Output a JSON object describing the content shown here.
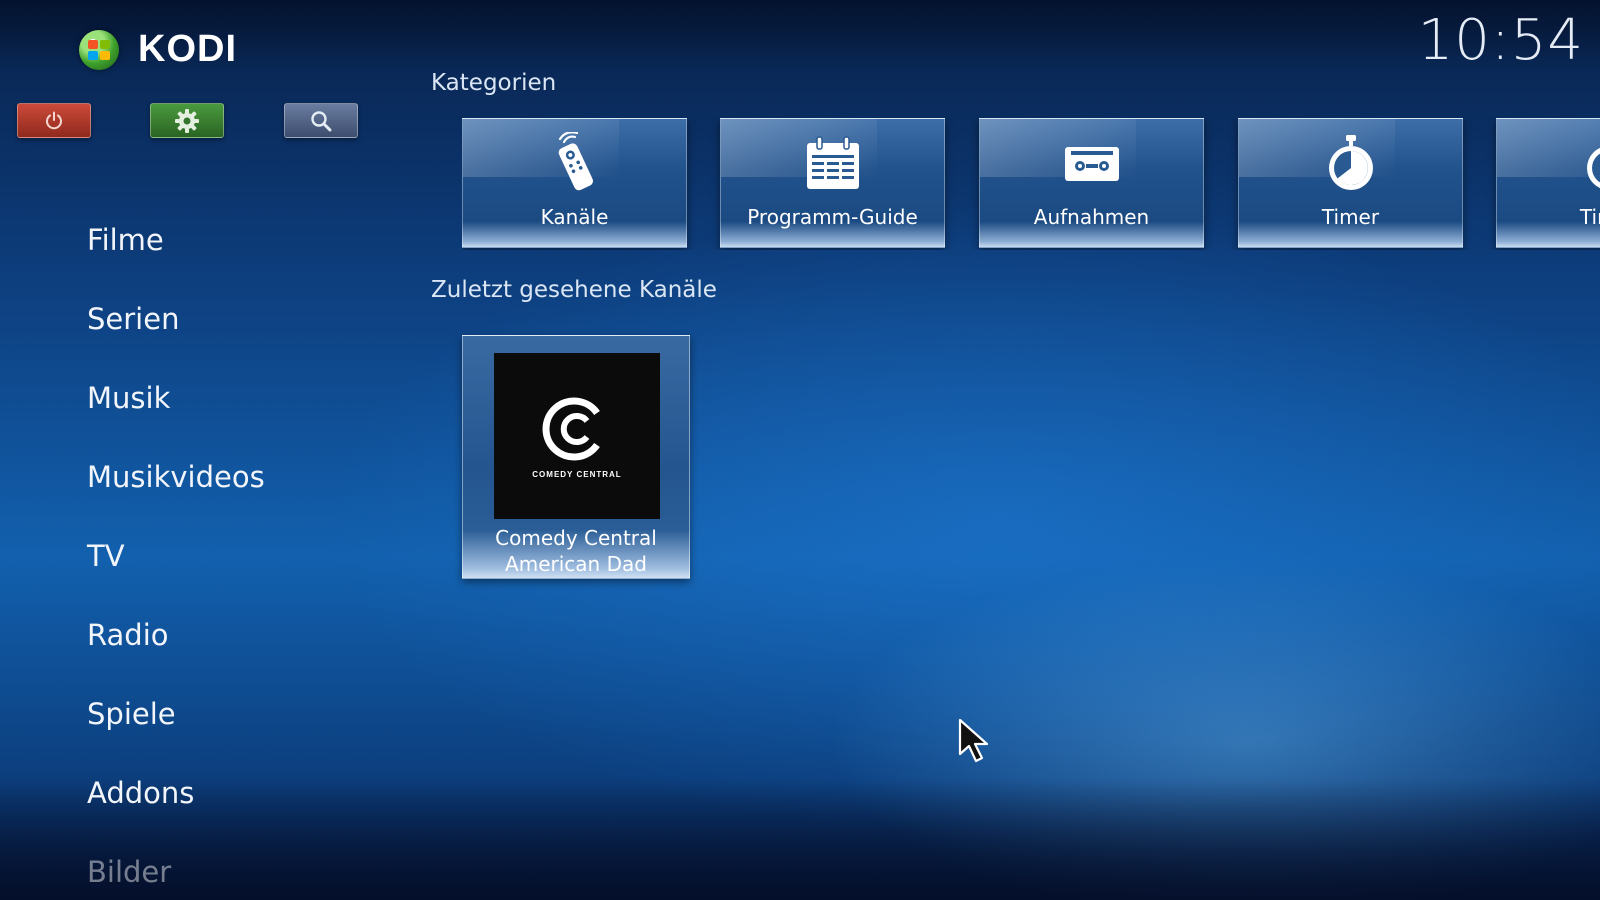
{
  "app": {
    "logo_text": "KODI",
    "clock": "10:54"
  },
  "top_buttons": [
    {
      "name": "power",
      "icon": "power-icon",
      "color": "#b23a2c"
    },
    {
      "name": "settings",
      "icon": "gear-icon",
      "color": "#3d8433"
    },
    {
      "name": "search",
      "icon": "search-icon",
      "color": "#55678a"
    }
  ],
  "sidebar": {
    "items": [
      {
        "label": "Filme"
      },
      {
        "label": "Serien"
      },
      {
        "label": "Musik"
      },
      {
        "label": "Musikvideos"
      },
      {
        "label": "TV"
      },
      {
        "label": "Radio"
      },
      {
        "label": "Spiele"
      },
      {
        "label": "Addons"
      },
      {
        "label": "Bilder"
      }
    ]
  },
  "categories": {
    "title": "Kategorien",
    "items": [
      {
        "label": "Kanäle",
        "icon": "remote-icon"
      },
      {
        "label": "Programm-Guide",
        "icon": "calendar-icon"
      },
      {
        "label": "Aufnahmen",
        "icon": "cassette-icon"
      },
      {
        "label": "Timer",
        "icon": "stopwatch-icon"
      },
      {
        "label": "Timer",
        "icon": "timer-rule-icon"
      }
    ]
  },
  "recent": {
    "title": "Zuletzt gesehene Kanäle",
    "items": [
      {
        "channel": "Comedy Central",
        "program": "American Dad",
        "logo_text": "COMEDY CENTRAL"
      }
    ]
  }
}
